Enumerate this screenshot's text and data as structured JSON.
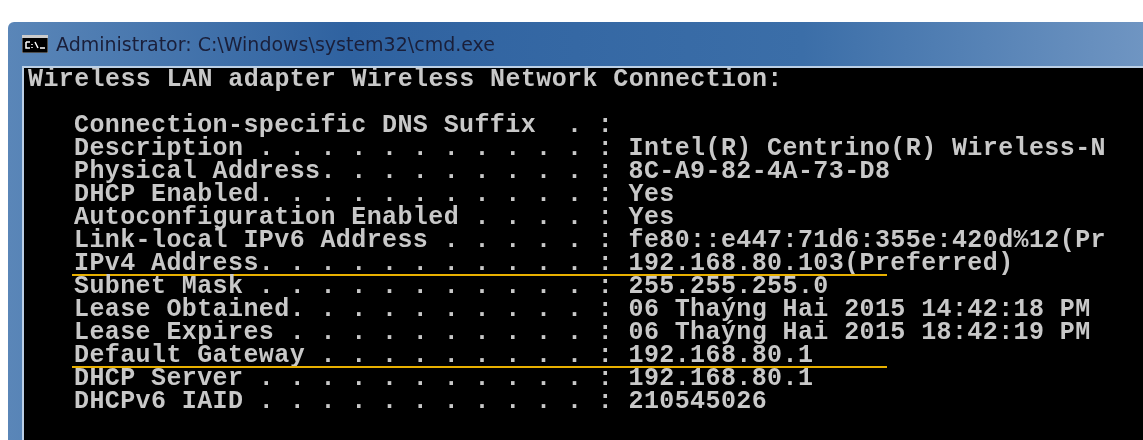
{
  "window": {
    "title": "Administrator: C:\\Windows\\system32\\cmd.exe"
  },
  "console": {
    "heading": "Wireless LAN adapter Wireless Network Connection:",
    "lines": [
      {
        "label": "Connection-specific DNS Suffix  . :",
        "underlined": false
      },
      {
        "label": "Description . . . . . . . . . . . :",
        "value": "Intel(R) Centrino(R) Wireless-N",
        "underlined": false
      },
      {
        "label": "Physical Address. . . . . . . . . :",
        "value": "8C-A9-82-4A-73-D8",
        "underlined": false
      },
      {
        "label": "DHCP Enabled. . . . . . . . . . . :",
        "value": "Yes",
        "underlined": false
      },
      {
        "label": "Autoconfiguration Enabled . . . . :",
        "value": "Yes",
        "underlined": false
      },
      {
        "label": "Link-local IPv6 Address . . . . . :",
        "value": "fe80::e447:71d6:355e:420d%12(Pr",
        "underlined": false
      },
      {
        "label": "IPv4 Address. . . . . . . . . . . :",
        "value": "192.168.80.103(Preferred)",
        "underlined": true
      },
      {
        "label": "Subnet Mask . . . . . . . . . . . :",
        "value": "255.255.255.0",
        "underlined": false
      },
      {
        "label": "Lease Obtained. . . . . . . . . . :",
        "value": "06 Thaýng Hai 2015 14:42:18 PM",
        "underlined": false
      },
      {
        "label": "Lease Expires . . . . . . . . . . :",
        "value": "06 Thaýng Hai 2015 18:42:19 PM",
        "underlined": false
      },
      {
        "label": "Default Gateway . . . . . . . . . :",
        "value": "192.168.80.1",
        "underlined": true
      },
      {
        "label": "DHCP Server . . . . . . . . . . . :",
        "value": "192.168.80.1",
        "underlined": false
      },
      {
        "label": "DHCPv6 IAID . . . . . . . . . . . :",
        "value": "210545026",
        "underlined": false
      }
    ]
  }
}
